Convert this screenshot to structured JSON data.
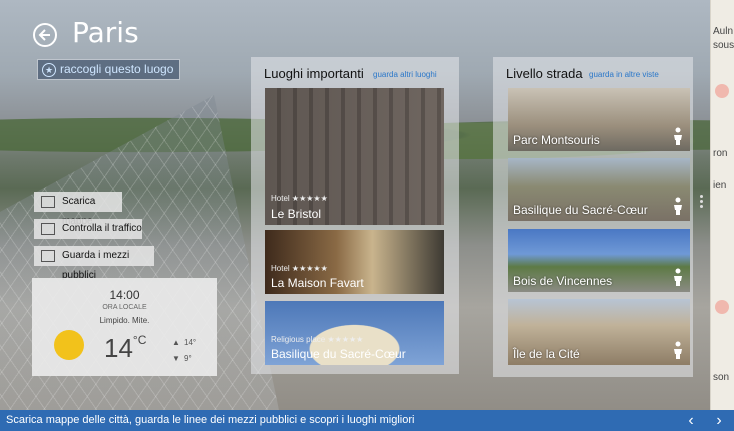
{
  "header": {
    "city": "Paris",
    "collect_label": "raccogli questo luogo"
  },
  "actions": [
    {
      "label": "Scarica mappe",
      "icon": "download-icon"
    },
    {
      "label": "Controlla il traffico",
      "icon": "car-icon"
    },
    {
      "label": "Guarda i mezzi pubblici",
      "icon": "bus-icon"
    }
  ],
  "weather": {
    "time": "14:00",
    "time_label": "ORA LOCALE",
    "condition": "Limpido. Mite.",
    "temp": "14",
    "unit": "°C",
    "high": "14°",
    "low": "9°",
    "icon": "sun-icon"
  },
  "landmarks": {
    "title": "Luoghi importanti",
    "link": "guarda altri luoghi",
    "items": [
      {
        "category": "Hotel ★★★★★",
        "name": "Le Bristol"
      },
      {
        "category": "Hotel ★★★★★",
        "name": "La Maison Favart"
      },
      {
        "category": "Religious place ★★★★★",
        "name": "Basilique du Sacré-Cœur"
      }
    ]
  },
  "streetside": {
    "title": "Livello strada",
    "link": "guarda in altre viste",
    "items": [
      {
        "name": "Parc Montsouris"
      },
      {
        "name": "Basilique du Sacré-Cœur"
      },
      {
        "name": "Bois de Vincennes"
      },
      {
        "name": "Île de la Cité"
      }
    ]
  },
  "map_edge": {
    "labels": [
      "Auln",
      "sous-",
      "ron",
      "ien",
      "son"
    ]
  },
  "bottom_bar": {
    "caption": "Scarica mappe delle città, guarda le linee dei mezzi pubblici e scopri i luoghi migliori",
    "prev": "‹",
    "next": "›"
  },
  "colors": {
    "accent": "#2f6bb3",
    "link": "#2a77c9",
    "sun": "#f2c21b"
  }
}
